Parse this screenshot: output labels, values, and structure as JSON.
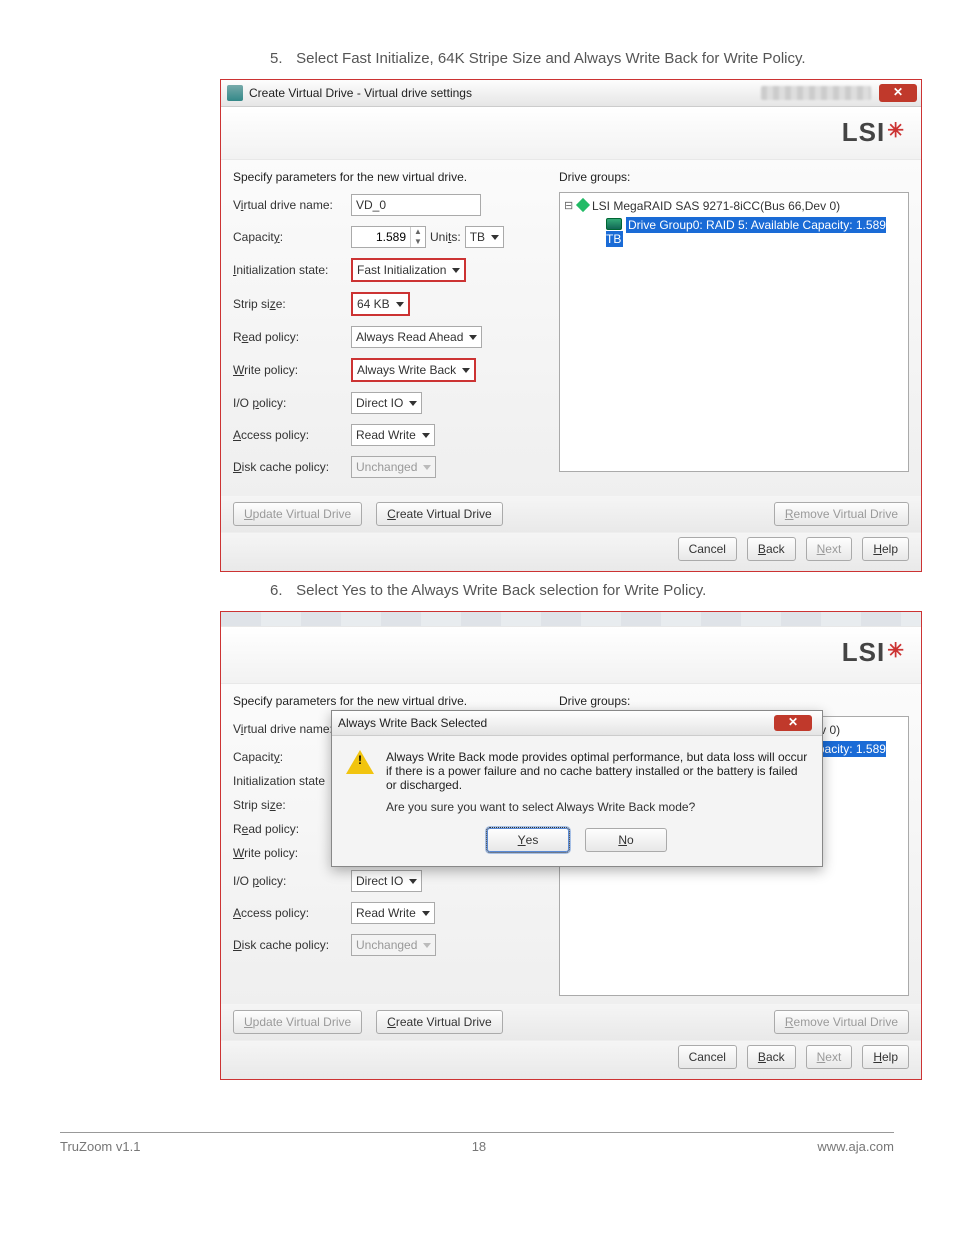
{
  "doc": {
    "step5_num": "5.",
    "step5_text": "Select Fast Initialize, 64K Stripe Size and Always Write Back for Write Policy.",
    "step6_num": "6.",
    "step6_text": "Select Yes to the Always Write Back selection for Write Policy."
  },
  "brand": "LSI",
  "win": {
    "title": "Create Virtual Drive - Virtual drive settings",
    "close_glyph": "✕",
    "prompt_left": "Specify parameters for the new virtual drive.",
    "prompt_right": "Drive groups:"
  },
  "form": {
    "vd_label_pre": "V",
    "vd_label_und": "i",
    "vd_label_post": "rtual drive name:",
    "vd_value": "VD_0",
    "cap_label_pre": "Capacit",
    "cap_label_und": "y",
    "cap_label_post": ":",
    "cap_value": "1.589",
    "units_label_pre": "Uni",
    "units_label_und": "t",
    "units_label_post": "s:",
    "units_value": "TB",
    "init_label_pre": "",
    "init_label_und": "I",
    "init_label_post": "nitialization state:",
    "init_value": "Fast Initialization",
    "strip_label_pre": "Strip si",
    "strip_label_und": "z",
    "strip_label_post": "e:",
    "strip_value": "64 KB",
    "read_label_pre": "R",
    "read_label_und": "e",
    "read_label_post": "ad policy:",
    "read_value": "Always Read Ahead",
    "write_label_pre": "",
    "write_label_und": "W",
    "write_label_post": "rite policy:",
    "write_value": "Always Write Back",
    "io_label_pre": "I/O ",
    "io_label_und": "p",
    "io_label_post": "olicy:",
    "io_value": "Direct IO",
    "access_label_pre": "",
    "access_label_und": "A",
    "access_label_post": "ccess policy:",
    "access_value": "Read Write",
    "disk_label_pre": "",
    "disk_label_und": "D",
    "disk_label_post": "isk cache policy:",
    "disk_value": "Unchanged"
  },
  "tree": {
    "controller": "LSI MegaRAID SAS 9271-8iCC(Bus 66,Dev 0)",
    "dg": "Drive Group0: RAID 5: Available Capacity: 1.589 TB"
  },
  "buttons": {
    "update_pre": "",
    "update_und": "U",
    "update_post": "pdate Virtual Drive",
    "create_pre": "",
    "create_und": "C",
    "create_post": "reate Virtual Drive",
    "remove_pre": "",
    "remove_und": "R",
    "remove_post": "emove Virtual Drive",
    "cancel": "Cancel",
    "back_und": "B",
    "back_post": "ack",
    "next_und": "N",
    "next_post": "ext",
    "help_und": "H",
    "help_post": "elp"
  },
  "modal": {
    "title": "Always Write Back Selected",
    "line1": "Always Write Back mode provides optimal performance, but data loss will occur if there is a power failure and no cache battery installed or the battery is failed or discharged.",
    "question": "Are you sure you want to select Always Write Back mode?",
    "yes_und": "Y",
    "yes_post": "es",
    "no_und": "N",
    "no_post": "o"
  },
  "shot2": {
    "init_label": "Initialization state",
    "io_partial": "Direct IO"
  },
  "footer": {
    "left": "TruZoom v1.1",
    "center": "18",
    "right": "www.aja.com"
  }
}
